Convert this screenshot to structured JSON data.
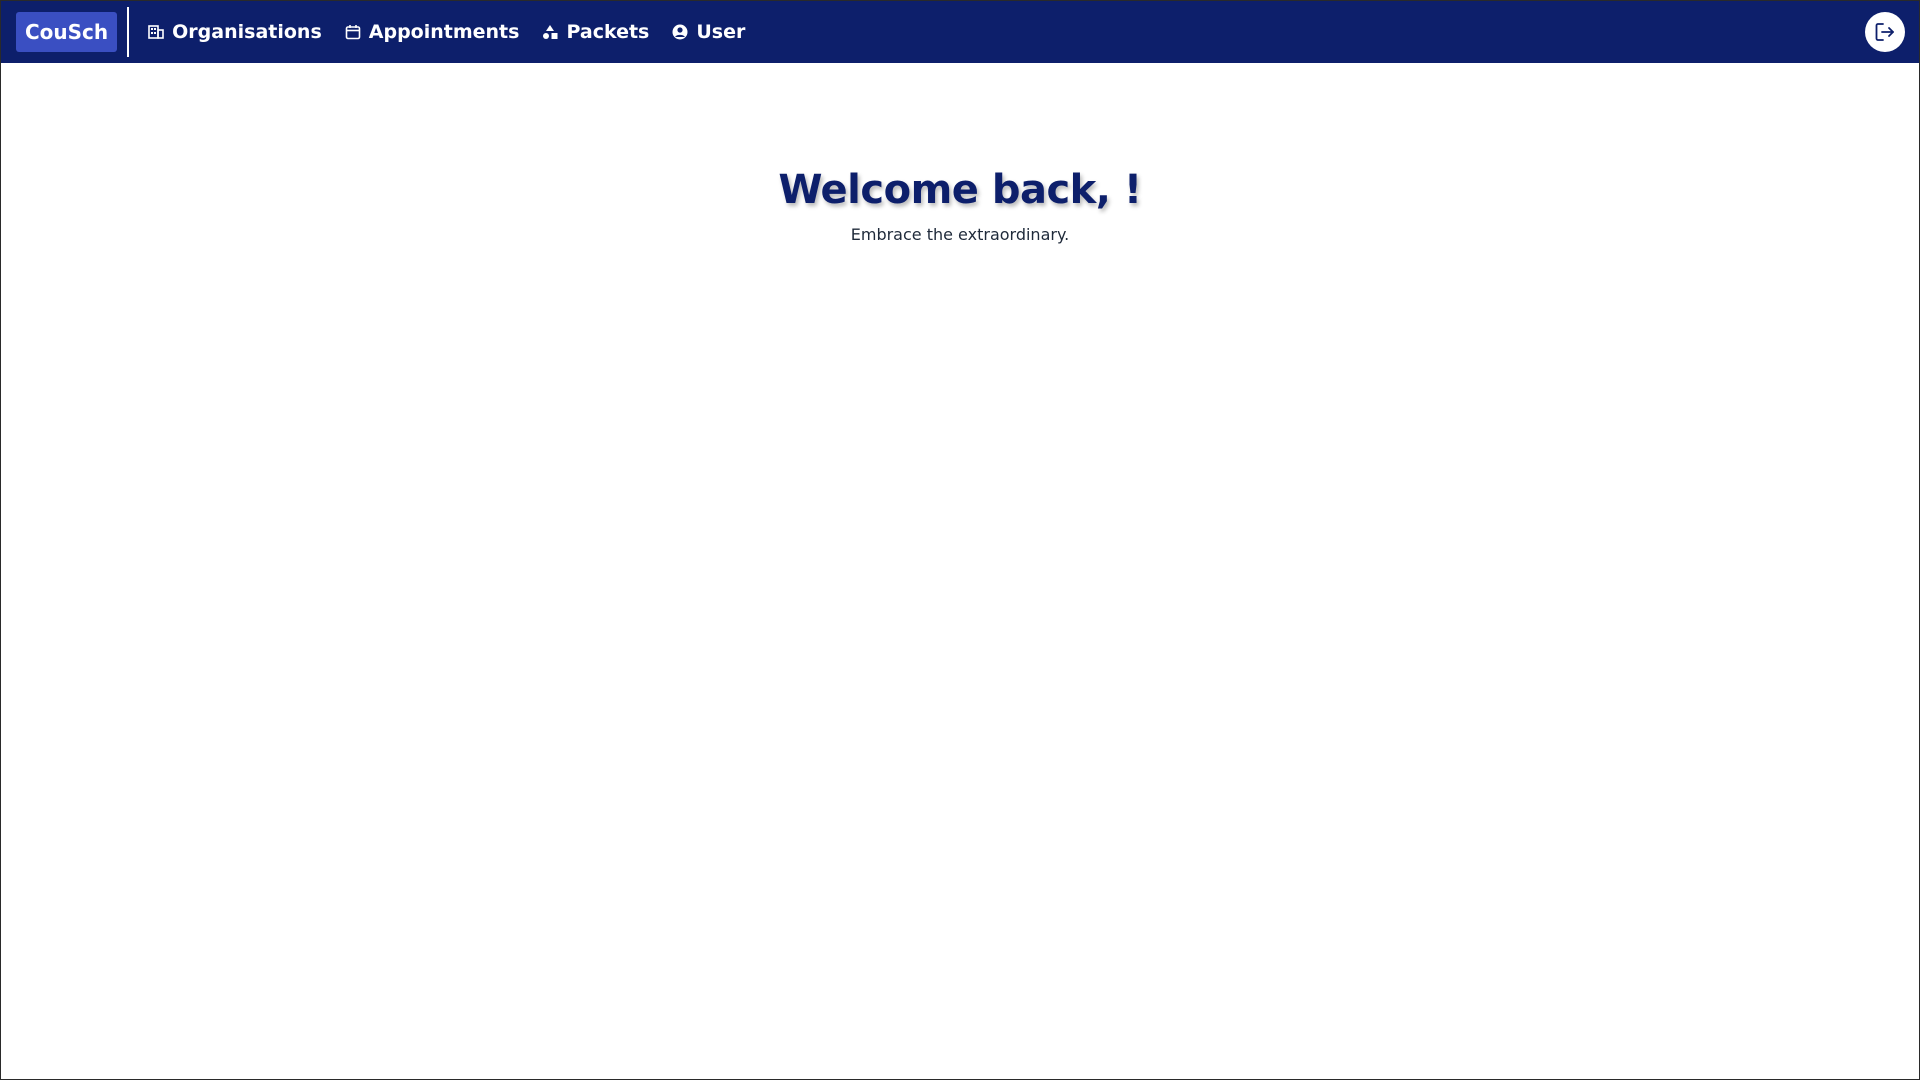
{
  "colors": {
    "navbar_bg": "#0d1f6b",
    "brand_bg": "#3a4fc2",
    "heading": "#0d1f6b"
  },
  "navbar": {
    "brand": "CouSch",
    "items": [
      {
        "label": "Organisations",
        "icon": "building-icon"
      },
      {
        "label": "Appointments",
        "icon": "calendar-icon"
      },
      {
        "label": "Packets",
        "icon": "shapes-icon"
      },
      {
        "label": "User",
        "icon": "user-circle-icon"
      }
    ],
    "logout_icon": "logout-icon"
  },
  "main": {
    "title": "Welcome back, !",
    "subtitle": "Embrace the extraordinary."
  }
}
